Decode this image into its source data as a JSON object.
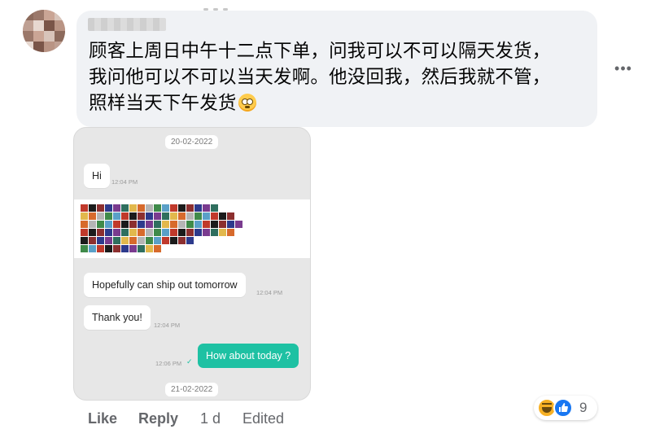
{
  "comment": {
    "author_name_redacted": true,
    "lines": [
      "顾客上周日中午十二点下单，问我可以不可以隔天发货，",
      "我问他可以不可以当天发啊。他没回我，然后我就不管，",
      "照样当天下午发货"
    ],
    "emoji": "flushed-face-emoji"
  },
  "more_button": "•••",
  "chat_screenshot": {
    "date_top": "20-02-2022",
    "messages": [
      {
        "direction": "in",
        "text": "Hi",
        "time": "12:04 PM"
      },
      {
        "direction": "in",
        "text": "Hopefully can ship out tomorrow",
        "time": "12:04 PM"
      },
      {
        "direction": "in",
        "text": "Thank you!",
        "time": "12:04 PM"
      },
      {
        "direction": "out",
        "text": "How about today ?",
        "time": "12:06 PM"
      }
    ],
    "date_bottom": "21-02-2022",
    "accent_color": "#1ec1a3"
  },
  "actions": {
    "like": "Like",
    "reply": "Reply",
    "age": "1 d",
    "edited": "Edited"
  },
  "reactions": {
    "icons": [
      "haha-icon",
      "like-icon"
    ],
    "count": "9"
  }
}
